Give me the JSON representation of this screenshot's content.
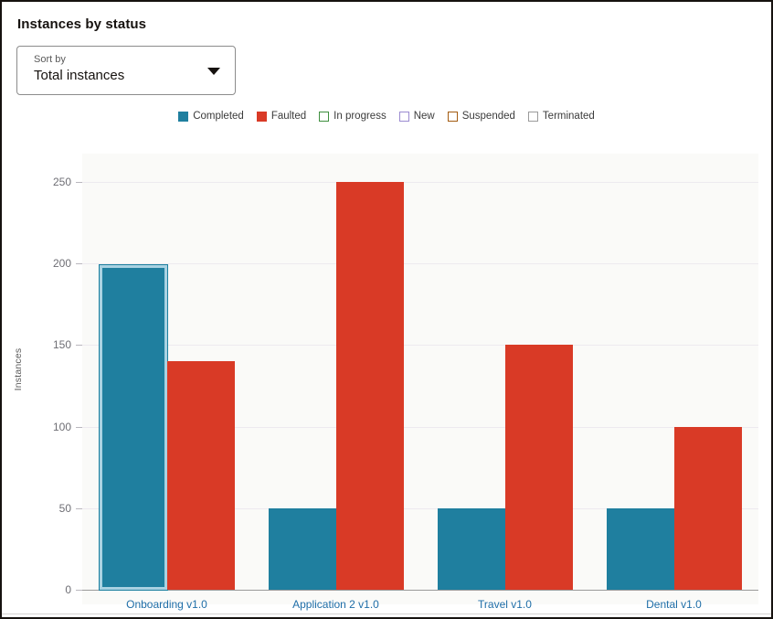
{
  "panel": {
    "title": "Instances by status"
  },
  "sort": {
    "label": "Sort by",
    "value": "Total instances",
    "chevron_icon": "chevron-down-icon",
    "options": [
      "Total instances"
    ]
  },
  "colors": {
    "completed": "#1f7f9f",
    "faulted": "#d93a26",
    "in_progress_outline": "#3f8f3f",
    "new_outline": "#9b8bd0",
    "suspended_outline": "#a35b10",
    "terminated_outline": "#9b9b9b",
    "plot_background": "#fafaf8",
    "gridline": "#edeaef",
    "axis_line": "#9a9a9a",
    "category_label": "#1f6ea8",
    "panel_border": "#16120f",
    "selection_highlight": "#a9d2e2"
  },
  "legend": [
    {
      "label": "Completed",
      "style": "fill",
      "color": "#1f7f9f"
    },
    {
      "label": "Faulted",
      "style": "fill",
      "color": "#d93a26"
    },
    {
      "label": "In progress",
      "style": "outline",
      "color": "#3f8f3f"
    },
    {
      "label": "New",
      "style": "outline",
      "color": "#9b8bd0"
    },
    {
      "label": "Suspended",
      "style": "outline",
      "color": "#a35b10"
    },
    {
      "label": "Terminated",
      "style": "outline",
      "color": "#9b9b9b"
    }
  ],
  "chart_data": {
    "type": "bar",
    "title": "Instances by status",
    "xlabel": "",
    "ylabel": "Instances",
    "ylim": [
      0,
      250
    ],
    "yticks": [
      0,
      50,
      100,
      150,
      200,
      250
    ],
    "grid": true,
    "legend_position": "top-center",
    "categories": [
      "Onboarding v1.0",
      "Application 2 v1.0",
      "Travel v1.0",
      "Dental v1.0"
    ],
    "series": [
      {
        "name": "Completed",
        "color": "#1f7f9f",
        "values": [
          199,
          50,
          50,
          50
        ]
      },
      {
        "name": "Faulted",
        "color": "#d93a26",
        "values": [
          140,
          250,
          150,
          100
        ]
      },
      {
        "name": "In progress",
        "color": "#3f8f3f",
        "values": [
          0,
          0,
          0,
          0
        ]
      },
      {
        "name": "New",
        "color": "#9b8bd0",
        "values": [
          0,
          0,
          0,
          0
        ]
      },
      {
        "name": "Suspended",
        "color": "#a35b10",
        "values": [
          0,
          0,
          0,
          0
        ]
      },
      {
        "name": "Terminated",
        "color": "#9b9b9b",
        "values": [
          0,
          0,
          0,
          0
        ]
      }
    ],
    "selected_bar": {
      "category": "Onboarding v1.0",
      "series": "Completed"
    }
  }
}
